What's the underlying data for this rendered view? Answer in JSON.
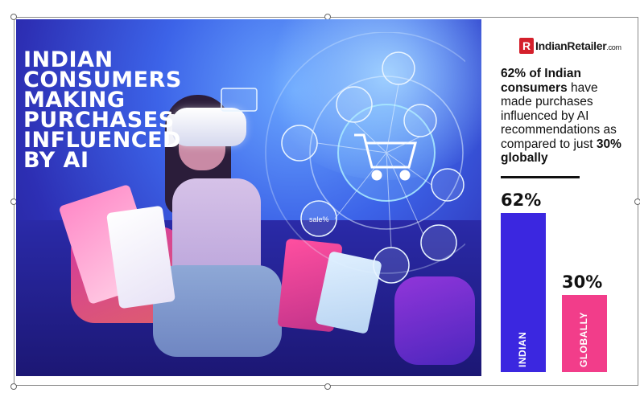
{
  "hero": {
    "title": "INDIAN\nCONSUMERS\nMAKING\nPURCHASES\nINFLUENCED\nBY AI",
    "sale_tag": "sale%"
  },
  "brand": {
    "mark": "R",
    "name": "IndianRetailer",
    "suffix": ".com"
  },
  "stat": {
    "pct_indian": "62%",
    "text_1": " of Indian ",
    "bold_2": "consumers",
    "text_3": " have made purchases influenced by AI recommendations as compared to just ",
    "pct_global": "30% globally"
  },
  "chart_data": {
    "type": "bar",
    "categories": [
      "INDIAN",
      "GLOBALLY"
    ],
    "values": [
      62,
      30
    ],
    "value_labels": [
      "62%",
      "30%"
    ],
    "colors": [
      "#3b27e0",
      "#f23d8a"
    ],
    "ylim": [
      0,
      62
    ]
  },
  "colors": {
    "bar_indian": "#3b27e0",
    "bar_global": "#f23d8a",
    "brand_red": "#d4202b"
  }
}
